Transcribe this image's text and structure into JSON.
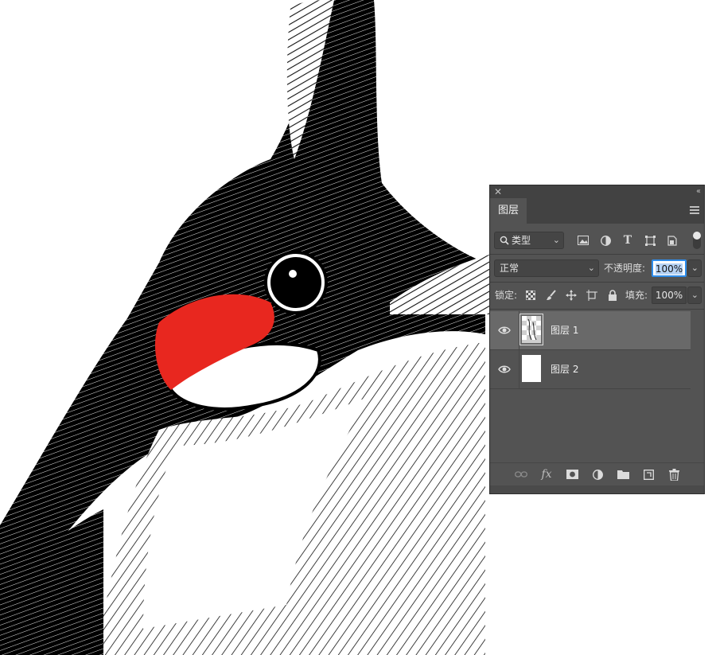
{
  "panel": {
    "tab_label": "图层",
    "filter": {
      "label": "类型",
      "icons": [
        "image-filter-icon",
        "adjustment-filter-icon",
        "type-filter-icon",
        "shape-filter-icon",
        "smart-object-filter-icon"
      ]
    },
    "blend_mode": "正常",
    "opacity_label": "不透明度:",
    "opacity_value": "100%",
    "lock_label": "锁定:",
    "fill_label": "填充:",
    "fill_value": "100%",
    "layers": [
      {
        "name": "图层 1",
        "selected": true,
        "visible": true
      },
      {
        "name": "图层 2",
        "selected": false,
        "visible": true
      }
    ]
  },
  "colors": {
    "panel_bg": "#535353",
    "selected_layer": "#696969",
    "accent": "#2d8ceb",
    "cheek_red": "#e8271f"
  }
}
